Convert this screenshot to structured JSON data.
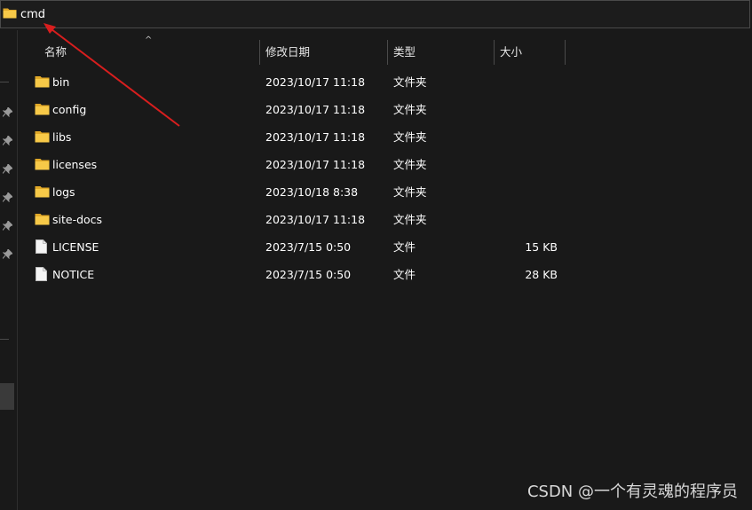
{
  "address_bar": {
    "path": "cmd"
  },
  "columns": {
    "name": "名称",
    "date": "修改日期",
    "type": "类型",
    "size": "大小"
  },
  "files": [
    {
      "name": "bin",
      "date": "2023/10/17 11:18",
      "type": "文件夹",
      "size": "",
      "icon": "folder-icon"
    },
    {
      "name": "config",
      "date": "2023/10/17 11:18",
      "type": "文件夹",
      "size": "",
      "icon": "folder-icon"
    },
    {
      "name": "libs",
      "date": "2023/10/17 11:18",
      "type": "文件夹",
      "size": "",
      "icon": "folder-icon"
    },
    {
      "name": "licenses",
      "date": "2023/10/17 11:18",
      "type": "文件夹",
      "size": "",
      "icon": "folder-icon"
    },
    {
      "name": "logs",
      "date": "2023/10/18 8:38",
      "type": "文件夹",
      "size": "",
      "icon": "folder-icon"
    },
    {
      "name": "site-docs",
      "date": "2023/10/17 11:18",
      "type": "文件夹",
      "size": "",
      "icon": "folder-icon"
    },
    {
      "name": "LICENSE",
      "date": "2023/7/15 0:50",
      "type": "文件",
      "size": "15 KB",
      "icon": "file-icon"
    },
    {
      "name": "NOTICE",
      "date": "2023/7/15 0:50",
      "type": "文件",
      "size": "28 KB",
      "icon": "file-icon"
    }
  ],
  "watermark": "CSDN @一个有灵魂的程序员",
  "colors": {
    "background": "#191919",
    "folder": "#f2c14e",
    "annotation_arrow": "#d81e1e"
  }
}
